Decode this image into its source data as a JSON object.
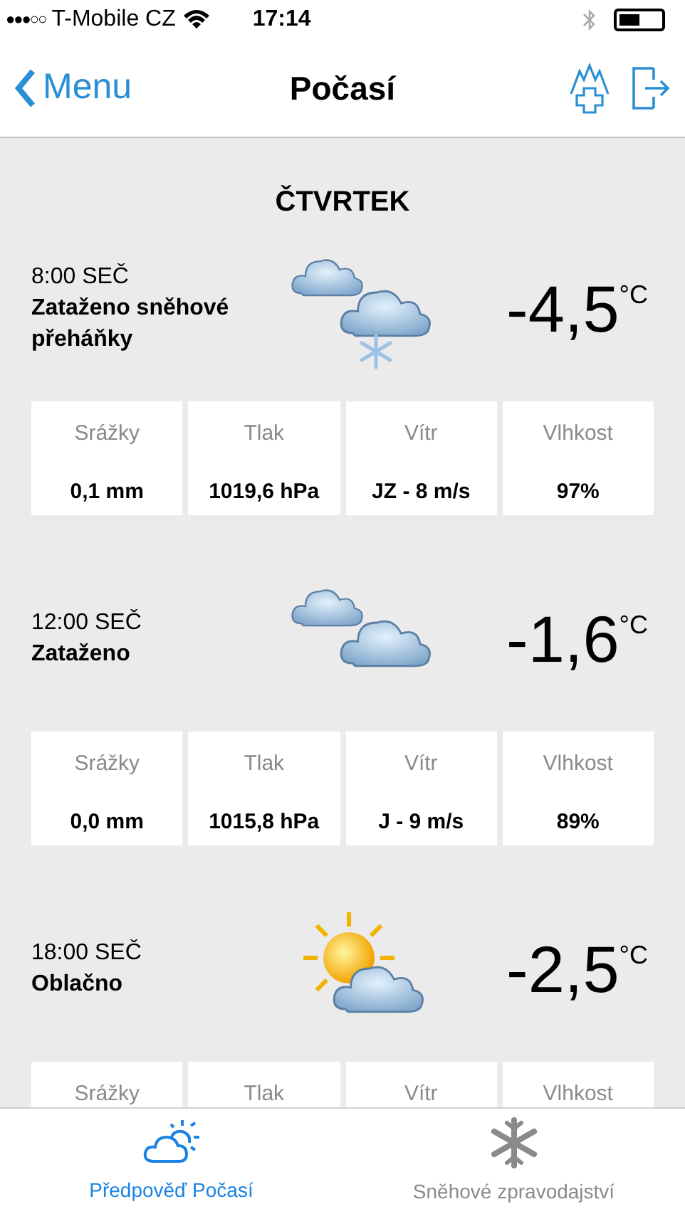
{
  "status_bar": {
    "carrier": "T-Mobile CZ",
    "time": "17:14",
    "signal_dots": "●●●○○"
  },
  "nav": {
    "back": "Menu",
    "title": "Počasí"
  },
  "day": "ČTVRTEK",
  "forecasts": [
    {
      "time": "8:00 SEČ",
      "description": "Zataženo sněhové přeháňky",
      "kind": "snow_showers",
      "temp": "-4,5",
      "unit": "°C",
      "stats": [
        {
          "label": "Srážky",
          "value": "0,1 mm"
        },
        {
          "label": "Tlak",
          "value": "1019,6 hPa"
        },
        {
          "label": "Vítr",
          "value": "JZ - 8 m/s"
        },
        {
          "label": "Vlhkost",
          "value": "97%"
        }
      ]
    },
    {
      "time": "12:00 SEČ",
      "description": "Zataženo",
      "kind": "overcast",
      "temp": "-1,6",
      "unit": "°C",
      "stats": [
        {
          "label": "Srážky",
          "value": "0,0 mm"
        },
        {
          "label": "Tlak",
          "value": "1015,8 hPa"
        },
        {
          "label": "Vítr",
          "value": "J - 9 m/s"
        },
        {
          "label": "Vlhkost",
          "value": "89%"
        }
      ]
    },
    {
      "time": "18:00 SEČ",
      "description": "Oblačno",
      "kind": "partly_cloudy",
      "temp": "-2,5",
      "unit": "°C",
      "stats": [
        {
          "label": "Srážky"
        },
        {
          "label": "Tlak"
        },
        {
          "label": "Vítr"
        },
        {
          "label": "Vlhkost"
        }
      ]
    }
  ],
  "tab_bar": [
    {
      "label": "Předpověď Počasí",
      "kind": "weather",
      "selected": true
    },
    {
      "label": "Sněhové zpravodajství",
      "kind": "snow",
      "selected": false
    }
  ]
}
